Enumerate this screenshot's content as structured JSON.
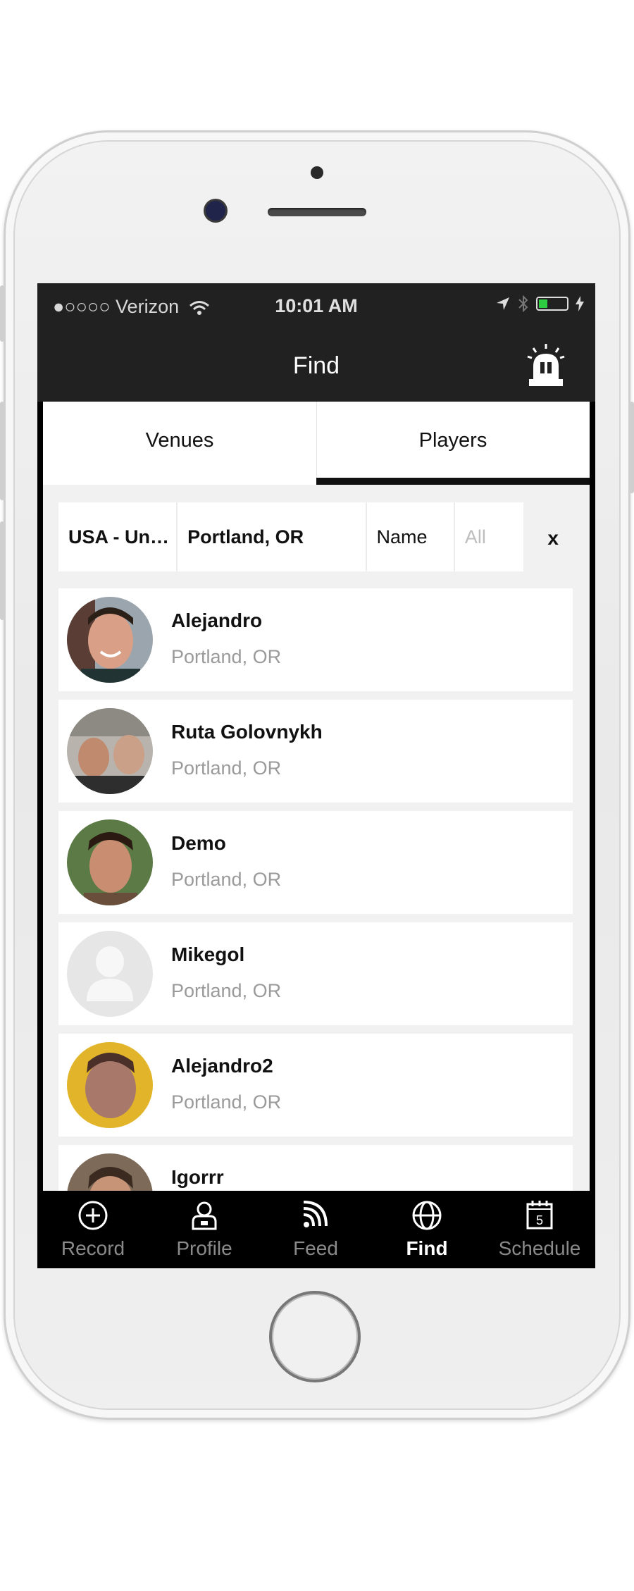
{
  "status_bar": {
    "carrier": "●○○○○ Verizon",
    "time": "10:01 AM"
  },
  "nav": {
    "title": "Find",
    "alarm_icon": "alarm-light-icon"
  },
  "segments": [
    {
      "label": "Venues",
      "selected": false
    },
    {
      "label": "Players",
      "selected": true
    }
  ],
  "filters": {
    "country": "USA  - Un…",
    "city": "Portland, OR",
    "field": "Name",
    "value_placeholder": "All",
    "clear": "x"
  },
  "players": [
    {
      "name": "Alejandro",
      "location": "Portland, OR",
      "avatar": "photo"
    },
    {
      "name": "Ruta Golovnykh",
      "location": "Portland, OR",
      "avatar": "photo"
    },
    {
      "name": "Demo",
      "location": "Portland, OR",
      "avatar": "photo"
    },
    {
      "name": "Mikegol",
      "location": "Portland, OR",
      "avatar": "placeholder-person-icon"
    },
    {
      "name": "Alejandro2",
      "location": "Portland, OR",
      "avatar": "photo"
    },
    {
      "name": "Igorrr",
      "location": "",
      "avatar": "photo"
    }
  ],
  "tabbar": [
    {
      "label": "Record",
      "icon": "plus-circle-icon",
      "active": false
    },
    {
      "label": "Profile",
      "icon": "profile-icon",
      "active": false
    },
    {
      "label": "Feed",
      "icon": "rss-feed-icon",
      "active": false
    },
    {
      "label": "Find",
      "icon": "globe-icon",
      "active": true
    },
    {
      "label": "Schedule",
      "icon": "calendar-icon",
      "active": false,
      "calendar_day": "5"
    }
  ],
  "colors": {
    "bar_dark": "#212121",
    "content_bg": "#f1f1f1",
    "secondary_text": "#9a9a9a",
    "battery_green": "#2ecc40"
  }
}
